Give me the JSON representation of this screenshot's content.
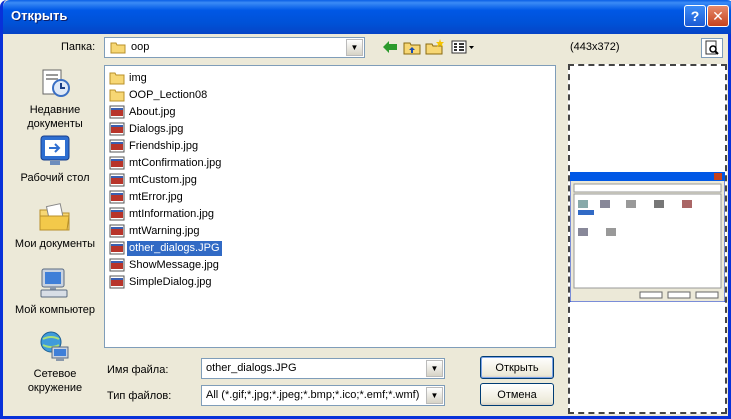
{
  "window": {
    "title": "Открыть"
  },
  "folder": {
    "label": "Папка:",
    "value": "oop"
  },
  "preview_size": "(443x372)",
  "places": [
    {
      "label": "Недавние документы",
      "icon": "recent-documents-icon"
    },
    {
      "label": "Рабочий стол",
      "icon": "desktop-icon"
    },
    {
      "label": "Мои документы",
      "icon": "my-documents-icon"
    },
    {
      "label": "Мой компьютер",
      "icon": "my-computer-icon"
    },
    {
      "label": "Сетевое окружение",
      "icon": "network-icon"
    }
  ],
  "files": [
    {
      "name": "img",
      "type": "folder"
    },
    {
      "name": "OOP_Lection08",
      "type": "folder"
    },
    {
      "name": "About.jpg",
      "type": "image"
    },
    {
      "name": "Dialogs.jpg",
      "type": "image"
    },
    {
      "name": "Friendship.jpg",
      "type": "image"
    },
    {
      "name": "mtConfirmation.jpg",
      "type": "image"
    },
    {
      "name": "mtCustom.jpg",
      "type": "image"
    },
    {
      "name": "mtError.jpg",
      "type": "image"
    },
    {
      "name": "mtInformation.jpg",
      "type": "image"
    },
    {
      "name": "mtWarning.jpg",
      "type": "image"
    },
    {
      "name": "other_dialogs.JPG",
      "type": "image",
      "selected": true
    },
    {
      "name": "ShowMessage.jpg",
      "type": "image"
    },
    {
      "name": "SimpleDialog.jpg",
      "type": "image"
    }
  ],
  "filename": {
    "label": "Имя файла:",
    "value": "other_dialogs.JPG"
  },
  "filetype": {
    "label": "Тип файлов:",
    "value": "All (*.gif;*.jpg;*.jpeg;*.bmp;*.ico;*.emf;*.wmf)"
  },
  "buttons": {
    "open": "Открыть",
    "cancel": "Отмена"
  },
  "colors": {
    "title_bar": "#0058e6",
    "selection": "#316ac5",
    "dialog_bg": "#ece9d8"
  }
}
